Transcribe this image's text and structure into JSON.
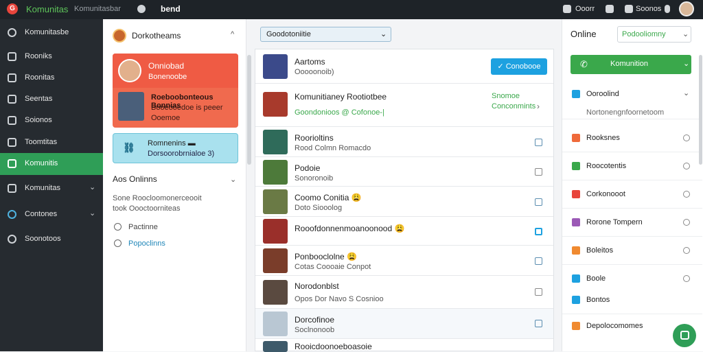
{
  "topbar": {
    "logo_letter": "G",
    "brand": "Komunitas",
    "subtitle": "Komunitasbar",
    "word": "bend",
    "right1": "Ooorr",
    "right2": "Soonos",
    "logo_color": "#e8453c",
    "brand_color": "#5ec45a"
  },
  "sidebar": {
    "items": [
      {
        "label": "Komunitasbe",
        "icon": "gauge-icon"
      },
      {
        "label": "Rooniks",
        "icon": "user-icon"
      },
      {
        "label": "Roonitas",
        "icon": "doc-icon"
      },
      {
        "label": "Seentas",
        "icon": "list-icon"
      },
      {
        "label": "Soionos",
        "icon": "pen-icon"
      },
      {
        "label": "Toomtitas",
        "icon": "lock-icon"
      },
      {
        "label": "Komunitis",
        "icon": "calendar-icon"
      },
      {
        "label": "Komunitas",
        "icon": "grid-icon"
      },
      {
        "label": "Contones",
        "icon": "globe-icon"
      },
      {
        "label": "Soonotoos",
        "icon": "settings-icon"
      }
    ],
    "active_color": "#2f9e57"
  },
  "panel1": {
    "title": "Dorkotheams",
    "card_red": {
      "name": "Onniobad",
      "sub": "Bonenoobe",
      "game_title": "Roeboobonteous Bonnias",
      "game_line1": "Booeooedoe is peeer",
      "game_line2": "Ooemoe"
    },
    "card_blue": {
      "title": "Romnenins ▬",
      "sub": "Dorsoorobrnialoe 3)"
    },
    "section_title": "Aos Onlinns",
    "desc1": "Sone Roocloomonerceooit",
    "desc2": "took Oooctoorniteas",
    "opt1": "Pactinne",
    "opt2": "Popoclinns"
  },
  "main": {
    "dropdown_value": "Goodotoniitie",
    "header_row": {
      "title": "Aartoms",
      "sub": "Ooooonoib)",
      "button": "✓ Conobooe"
    },
    "featured": {
      "title": "Komunitianey Rootiotbee",
      "sub": "Goondonioos @ Cofonoe-|",
      "link1": "Snomoe",
      "link2": "Conconmints"
    },
    "rows": [
      {
        "title": "Roorioltins",
        "sub": "Rood Colmn Romacdo"
      },
      {
        "title": "Podoie",
        "sub": "Sonoronoib"
      },
      {
        "title": "Coomo Conitia 😩",
        "sub": "Doto Siooolog"
      },
      {
        "title": "Rooofdonnenmoanoonood 😩",
        "sub": ""
      },
      {
        "title": "Ponbooclolne 😩",
        "sub": "Cotas Coooaie Conpot"
      },
      {
        "title": "Norodonblst",
        "sub": "Opos Dor Navo S Cosnioo"
      },
      {
        "title": "Dorcofinoe",
        "sub": "Soclnonoob"
      },
      {
        "title": "Rooicdoonoeboasoie",
        "sub": ""
      }
    ]
  },
  "right": {
    "title": "Online",
    "select_value": "Podooliomny",
    "button_label": "Komunition",
    "items": [
      {
        "label": "Ooroolind",
        "color": "#1da1e0",
        "trail": "chevron"
      },
      {
        "label": "Rooksnes",
        "color": "#ef6a3a",
        "trail": "radio"
      },
      {
        "label": "Roocotentis",
        "color": "#3aa84b",
        "trail": "radio"
      },
      {
        "label": "Corkonooot",
        "color": "#e8453c",
        "trail": "radio"
      },
      {
        "label": "Rorone Tompern",
        "color": "#9b59b6",
        "trail": "radio"
      },
      {
        "label": "Boleitos",
        "color": "#f08a30",
        "trail": "radio"
      },
      {
        "label": "Boole",
        "color": "#1da1e0",
        "trail": "radio"
      },
      {
        "label": "Bontos",
        "color": "#1da1e0",
        "trail": "none"
      },
      {
        "label": "Depolocomomes",
        "color": "#f08a30",
        "trail": "none"
      }
    ],
    "sub_note": "Nortonengnfoornetoom"
  }
}
